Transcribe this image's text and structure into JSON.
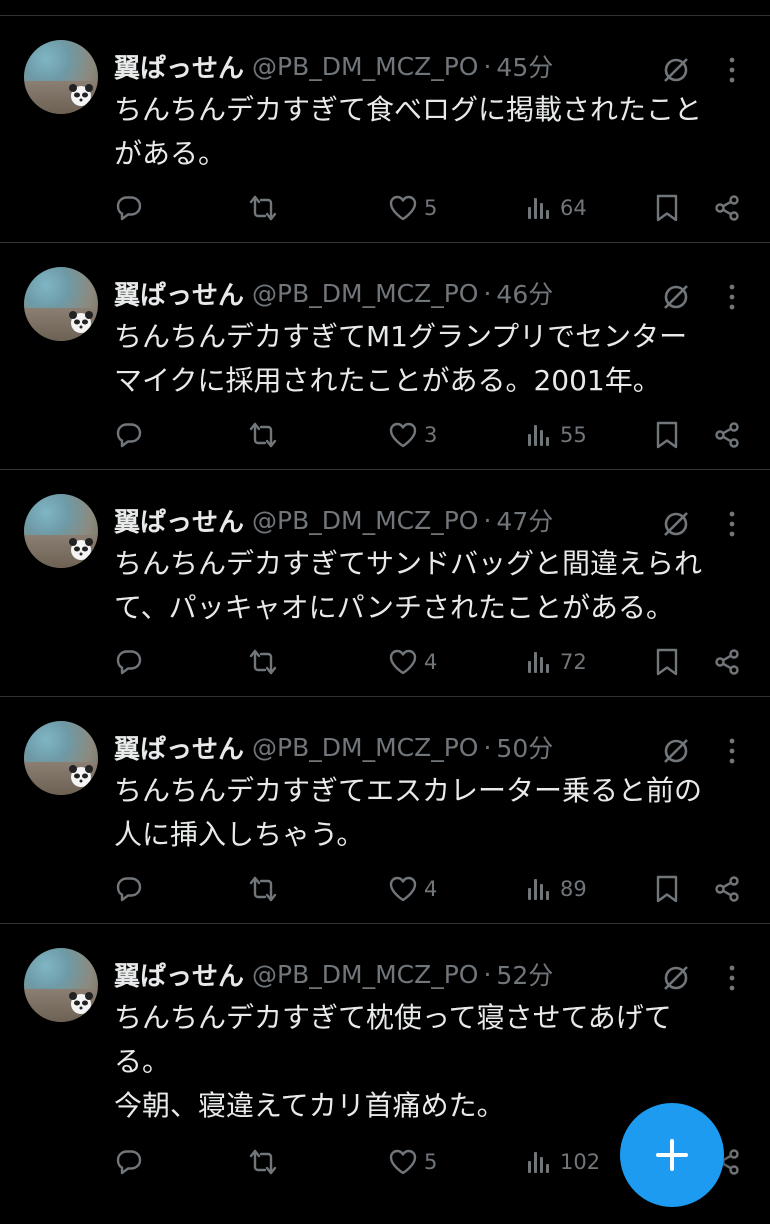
{
  "theme": {
    "background": "#000000",
    "text": "#e7e9ea",
    "muted": "#71767b",
    "divider": "#2f3336",
    "accent": "#1d9bf0"
  },
  "tweets": [
    {
      "display_name": "翼ぱっせん",
      "handle": "@PB_DM_MCZ_PO",
      "separator": "·",
      "time": "45分",
      "lines": [
        "ちんちんデカすぎて食べログに掲載されたこと",
        "がある。"
      ],
      "replies": "",
      "retweets": "",
      "likes": "5",
      "views": "64",
      "icons": [
        "grok-icon",
        "more-icon",
        "reply-icon",
        "retweet-icon",
        "like-icon",
        "views-icon",
        "bookmark-icon",
        "share-icon"
      ]
    },
    {
      "display_name": "翼ぱっせん",
      "handle": "@PB_DM_MCZ_PO",
      "separator": "·",
      "time": "46分",
      "lines": [
        "ちんちんデカすぎてM1グランプリでセンター",
        "マイクに採用されたことがある。2001年。"
      ],
      "replies": "",
      "retweets": "",
      "likes": "3",
      "views": "55",
      "icons": [
        "grok-icon",
        "more-icon",
        "reply-icon",
        "retweet-icon",
        "like-icon",
        "views-icon",
        "bookmark-icon",
        "share-icon"
      ]
    },
    {
      "display_name": "翼ぱっせん",
      "handle": "@PB_DM_MCZ_PO",
      "separator": "·",
      "time": "47分",
      "lines": [
        "ちんちんデカすぎてサンドバッグと間違えられ",
        "て、パッキャオにパンチされたことがある。"
      ],
      "replies": "",
      "retweets": "",
      "likes": "4",
      "views": "72",
      "icons": [
        "grok-icon",
        "more-icon",
        "reply-icon",
        "retweet-icon",
        "like-icon",
        "views-icon",
        "bookmark-icon",
        "share-icon"
      ]
    },
    {
      "display_name": "翼ぱっせん",
      "handle": "@PB_DM_MCZ_PO",
      "separator": "·",
      "time": "50分",
      "lines": [
        "ちんちんデカすぎてエスカレーター乗ると前の",
        "人に挿入しちゃう。"
      ],
      "replies": "",
      "retweets": "",
      "likes": "4",
      "views": "89",
      "icons": [
        "grok-icon",
        "more-icon",
        "reply-icon",
        "retweet-icon",
        "like-icon",
        "views-icon",
        "bookmark-icon",
        "share-icon"
      ]
    },
    {
      "display_name": "翼ぱっせん",
      "handle": "@PB_DM_MCZ_PO",
      "separator": "·",
      "time": "52分",
      "lines": [
        "ちんちんデカすぎて枕使って寝させてあげて",
        "る。",
        "今朝、寝違えてカリ首痛めた。"
      ],
      "replies": "",
      "retweets": "",
      "likes": "5",
      "views": "102",
      "icons": [
        "grok-icon",
        "more-icon",
        "reply-icon",
        "retweet-icon",
        "like-icon",
        "views-icon",
        "bookmark-icon",
        "share-icon"
      ]
    }
  ],
  "fab": {
    "icon": "plus-icon"
  }
}
